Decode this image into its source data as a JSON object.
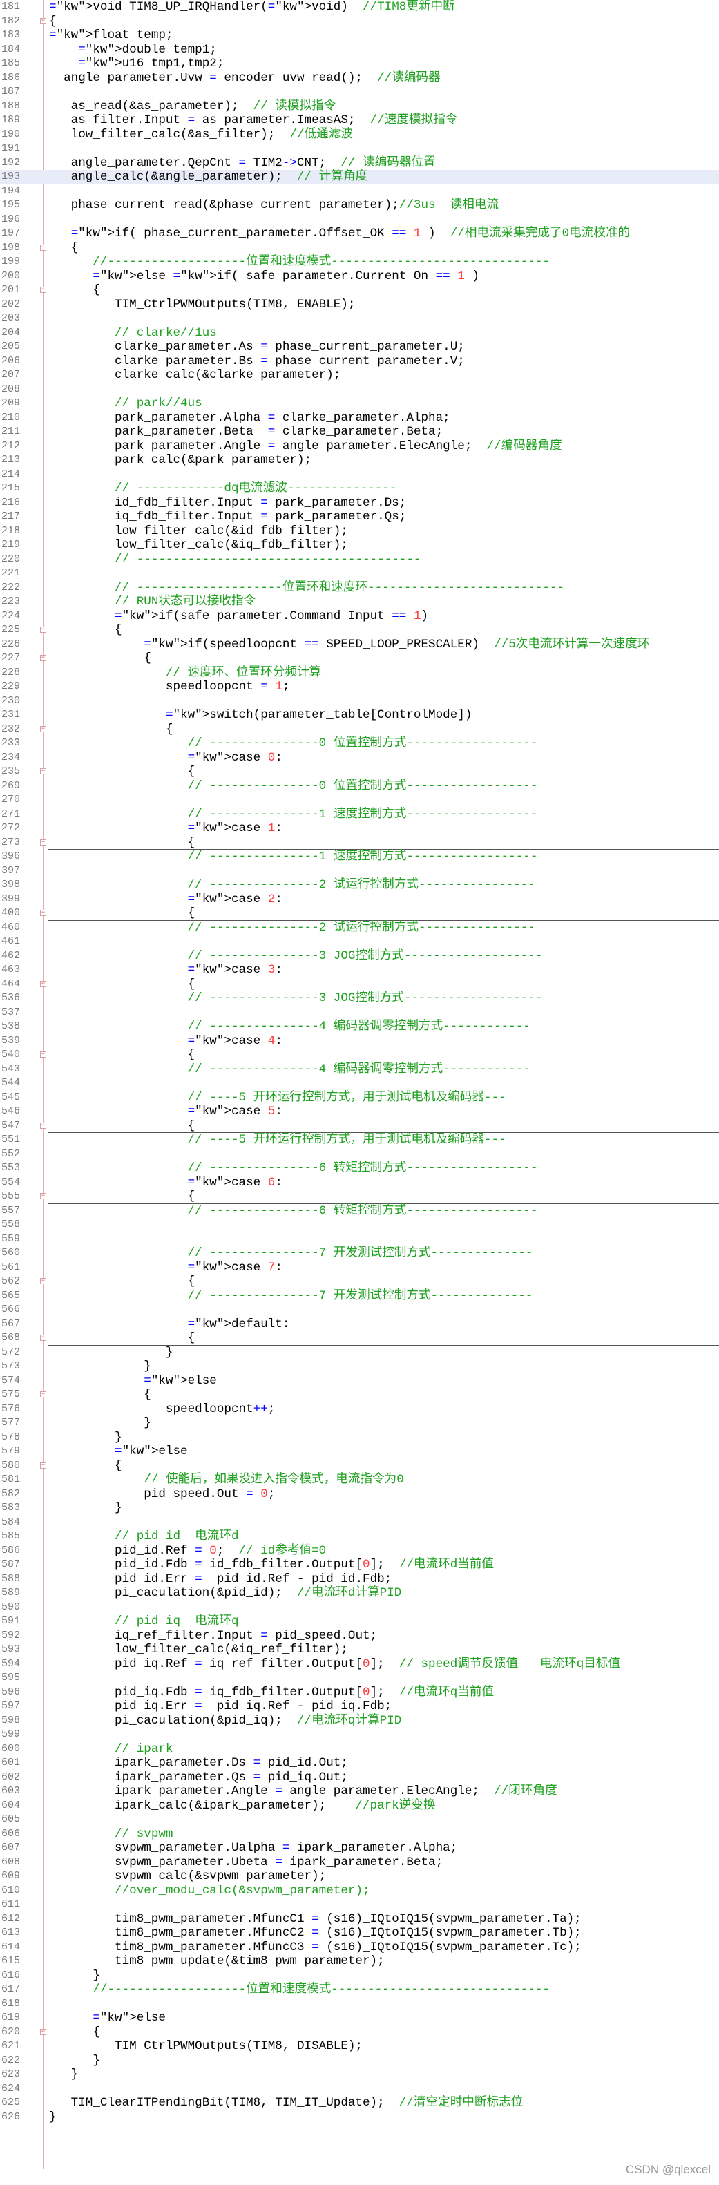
{
  "editor": {
    "lines": [
      {
        "n": "181",
        "t": "void TIM8_UP_IRQHandler(void)  //TIM8更新中断"
      },
      {
        "n": "182",
        "t": "{"
      },
      {
        "n": "183",
        "t": "float temp;"
      },
      {
        "n": "184",
        "t": "    double temp1;"
      },
      {
        "n": "185",
        "t": "    u16 tmp1,tmp2;"
      },
      {
        "n": "186",
        "t": "  angle_parameter.Uvw = encoder_uvw_read();  //读编码器"
      },
      {
        "n": "187",
        "t": ""
      },
      {
        "n": "188",
        "t": "   as_read(&as_parameter);  // 读模拟指令"
      },
      {
        "n": "189",
        "t": "   as_filter.Input = as_parameter.ImeasAS;  //速度模拟指令"
      },
      {
        "n": "190",
        "t": "   low_filter_calc(&as_filter);  //低通滤波"
      },
      {
        "n": "191",
        "t": ""
      },
      {
        "n": "192",
        "t": "   angle_parameter.QepCnt = TIM2->CNT;  // 读编码器位置"
      },
      {
        "n": "193",
        "t": "   angle_calc(&angle_parameter);  // 计算角度"
      },
      {
        "n": "194",
        "t": ""
      },
      {
        "n": "195",
        "t": "   phase_current_read(&phase_current_parameter);//3us  读相电流"
      },
      {
        "n": "196",
        "t": ""
      },
      {
        "n": "197",
        "t": "   if( phase_current_parameter.Offset_OK == 1 )  //相电流采集完成了0电流校准的"
      },
      {
        "n": "198",
        "t": "   {"
      },
      {
        "n": "199",
        "t": "      //-------------------位置和速度模式------------------------------"
      },
      {
        "n": "200",
        "t": "      else if( safe_parameter.Current_On == 1 )"
      },
      {
        "n": "201",
        "t": "      {"
      },
      {
        "n": "202",
        "t": "         TIM_CtrlPWMOutputs(TIM8, ENABLE);"
      },
      {
        "n": "203",
        "t": ""
      },
      {
        "n": "204",
        "t": "         // clarke//1us"
      },
      {
        "n": "205",
        "t": "         clarke_parameter.As = phase_current_parameter.U;"
      },
      {
        "n": "206",
        "t": "         clarke_parameter.Bs = phase_current_parameter.V;"
      },
      {
        "n": "207",
        "t": "         clarke_calc(&clarke_parameter);"
      },
      {
        "n": "208",
        "t": ""
      },
      {
        "n": "209",
        "t": "         // park//4us"
      },
      {
        "n": "210",
        "t": "         park_parameter.Alpha = clarke_parameter.Alpha;"
      },
      {
        "n": "211",
        "t": "         park_parameter.Beta  = clarke_parameter.Beta;"
      },
      {
        "n": "212",
        "t": "         park_parameter.Angle = angle_parameter.ElecAngle;  //编码器角度"
      },
      {
        "n": "213",
        "t": "         park_calc(&park_parameter);"
      },
      {
        "n": "214",
        "t": ""
      },
      {
        "n": "215",
        "t": "         // ------------dq电流滤波---------------"
      },
      {
        "n": "216",
        "t": "         id_fdb_filter.Input = park_parameter.Ds;"
      },
      {
        "n": "217",
        "t": "         iq_fdb_filter.Input = park_parameter.Qs;"
      },
      {
        "n": "218",
        "t": "         low_filter_calc(&id_fdb_filter);"
      },
      {
        "n": "219",
        "t": "         low_filter_calc(&iq_fdb_filter);"
      },
      {
        "n": "220",
        "t": "         // ---------------------------------------"
      },
      {
        "n": "221",
        "t": ""
      },
      {
        "n": "222",
        "t": "         // --------------------位置环和速度环---------------------------"
      },
      {
        "n": "223",
        "t": "         // RUN状态可以接收指令"
      },
      {
        "n": "224",
        "t": "         if(safe_parameter.Command_Input == 1)"
      },
      {
        "n": "225",
        "t": "         {"
      },
      {
        "n": "226",
        "t": "             if(speedloopcnt == SPEED_LOOP_PRESCALER)  //5次电流环计算一次速度环"
      },
      {
        "n": "227",
        "t": "             {"
      },
      {
        "n": "228",
        "t": "                // 速度环、位置环分频计算"
      },
      {
        "n": "229",
        "t": "                speedloopcnt = 1;"
      },
      {
        "n": "230",
        "t": ""
      },
      {
        "n": "231",
        "t": "                switch(parameter_table[ControlMode])"
      },
      {
        "n": "232",
        "t": "                {"
      },
      {
        "n": "233",
        "t": "                   // ---------------0 位置控制方式------------------"
      },
      {
        "n": "234",
        "t": "                   case 0:"
      },
      {
        "n": "235",
        "t": "                   {"
      },
      {
        "n": "269",
        "t": "                   // ---------------0 位置控制方式------------------"
      },
      {
        "n": "270",
        "t": ""
      },
      {
        "n": "271",
        "t": "                   // ---------------1 速度控制方式------------------"
      },
      {
        "n": "272",
        "t": "                   case 1:"
      },
      {
        "n": "273",
        "t": "                   {"
      },
      {
        "n": "396",
        "t": "                   // ---------------1 速度控制方式------------------"
      },
      {
        "n": "397",
        "t": ""
      },
      {
        "n": "398",
        "t": "                   // ---------------2 试运行控制方式----------------"
      },
      {
        "n": "399",
        "t": "                   case 2:"
      },
      {
        "n": "400",
        "t": "                   {"
      },
      {
        "n": "460",
        "t": "                   // ---------------2 试运行控制方式----------------"
      },
      {
        "n": "461",
        "t": ""
      },
      {
        "n": "462",
        "t": "                   // ---------------3 JOG控制方式-------------------"
      },
      {
        "n": "463",
        "t": "                   case 3:"
      },
      {
        "n": "464",
        "t": "                   {"
      },
      {
        "n": "536",
        "t": "                   // ---------------3 JOG控制方式-------------------"
      },
      {
        "n": "537",
        "t": ""
      },
      {
        "n": "538",
        "t": "                   // ---------------4 编码器调零控制方式------------"
      },
      {
        "n": "539",
        "t": "                   case 4:"
      },
      {
        "n": "540",
        "t": "                   {"
      },
      {
        "n": "543",
        "t": "                   // ---------------4 编码器调零控制方式------------"
      },
      {
        "n": "544",
        "t": ""
      },
      {
        "n": "545",
        "t": "                   // ----5 开环运行控制方式，用于测试电机及编码器---"
      },
      {
        "n": "546",
        "t": "                   case 5:"
      },
      {
        "n": "547",
        "t": "                   {"
      },
      {
        "n": "551",
        "t": "                   // ----5 开环运行控制方式，用于测试电机及编码器---"
      },
      {
        "n": "552",
        "t": ""
      },
      {
        "n": "553",
        "t": "                   // ---------------6 转矩控制方式------------------"
      },
      {
        "n": "554",
        "t": "                   case 6:"
      },
      {
        "n": "555",
        "t": "                   {"
      },
      {
        "n": "557",
        "t": "                   // ---------------6 转矩控制方式------------------"
      },
      {
        "n": "558",
        "t": ""
      },
      {
        "n": "559",
        "t": ""
      },
      {
        "n": "560",
        "t": "                   // ---------------7 开发测试控制方式--------------"
      },
      {
        "n": "561",
        "t": "                   case 7:"
      },
      {
        "n": "562",
        "t": "                   {"
      },
      {
        "n": "565",
        "t": "                   // ---------------7 开发测试控制方式--------------"
      },
      {
        "n": "566",
        "t": ""
      },
      {
        "n": "567",
        "t": "                   default:"
      },
      {
        "n": "568",
        "t": "                   {"
      },
      {
        "n": "572",
        "t": "                }"
      },
      {
        "n": "573",
        "t": "             }"
      },
      {
        "n": "574",
        "t": "             else"
      },
      {
        "n": "575",
        "t": "             {"
      },
      {
        "n": "576",
        "t": "                speedloopcnt++;"
      },
      {
        "n": "577",
        "t": "             }"
      },
      {
        "n": "578",
        "t": "         }"
      },
      {
        "n": "579",
        "t": "         else"
      },
      {
        "n": "580",
        "t": "         {"
      },
      {
        "n": "581",
        "t": "             // 使能后，如果没进入指令模式，电流指令为0"
      },
      {
        "n": "582",
        "t": "             pid_speed.Out = 0;"
      },
      {
        "n": "583",
        "t": "         }"
      },
      {
        "n": "584",
        "t": ""
      },
      {
        "n": "585",
        "t": "         // pid_id  电流环d"
      },
      {
        "n": "586",
        "t": "         pid_id.Ref = 0;  // id参考值=0"
      },
      {
        "n": "587",
        "t": "         pid_id.Fdb = id_fdb_filter.Output[0];  //电流环d当前值"
      },
      {
        "n": "588",
        "t": "         pid_id.Err =  pid_id.Ref - pid_id.Fdb;"
      },
      {
        "n": "589",
        "t": "         pi_caculation(&pid_id);  //电流环d计算PID"
      },
      {
        "n": "590",
        "t": ""
      },
      {
        "n": "591",
        "t": "         // pid_iq  电流环q"
      },
      {
        "n": "592",
        "t": "         iq_ref_filter.Input = pid_speed.Out;"
      },
      {
        "n": "593",
        "t": "         low_filter_calc(&iq_ref_filter);"
      },
      {
        "n": "594",
        "t": "         pid_iq.Ref = iq_ref_filter.Output[0];  // speed调节反馈值   电流环q目标值"
      },
      {
        "n": "595",
        "t": ""
      },
      {
        "n": "596",
        "t": "         pid_iq.Fdb = iq_fdb_filter.Output[0];  //电流环q当前值"
      },
      {
        "n": "597",
        "t": "         pid_iq.Err =  pid_iq.Ref - pid_iq.Fdb;"
      },
      {
        "n": "598",
        "t": "         pi_caculation(&pid_iq);  //电流环q计算PID"
      },
      {
        "n": "599",
        "t": ""
      },
      {
        "n": "600",
        "t": "         // ipark"
      },
      {
        "n": "601",
        "t": "         ipark_parameter.Ds = pid_id.Out;"
      },
      {
        "n": "602",
        "t": "         ipark_parameter.Qs = pid_iq.Out;"
      },
      {
        "n": "603",
        "t": "         ipark_parameter.Angle = angle_parameter.ElecAngle;  //闭环角度"
      },
      {
        "n": "604",
        "t": "         ipark_calc(&ipark_parameter);    //park逆变换"
      },
      {
        "n": "605",
        "t": ""
      },
      {
        "n": "606",
        "t": "         // svpwm"
      },
      {
        "n": "607",
        "t": "         svpwm_parameter.Ualpha = ipark_parameter.Alpha;"
      },
      {
        "n": "608",
        "t": "         svpwm_parameter.Ubeta = ipark_parameter.Beta;"
      },
      {
        "n": "609",
        "t": "         svpwm_calc(&svpwm_parameter);"
      },
      {
        "n": "610",
        "t": "         //over_modu_calc(&svpwm_parameter);"
      },
      {
        "n": "611",
        "t": ""
      },
      {
        "n": "612",
        "t": "         tim8_pwm_parameter.MfuncC1 = (s16)_IQtoIQ15(svpwm_parameter.Ta);"
      },
      {
        "n": "613",
        "t": "         tim8_pwm_parameter.MfuncC2 = (s16)_IQtoIQ15(svpwm_parameter.Tb);"
      },
      {
        "n": "614",
        "t": "         tim8_pwm_parameter.MfuncC3 = (s16)_IQtoIQ15(svpwm_parameter.Tc);"
      },
      {
        "n": "615",
        "t": "         tim8_pwm_update(&tim8_pwm_parameter);"
      },
      {
        "n": "616",
        "t": "      }"
      },
      {
        "n": "617",
        "t": "      //-------------------位置和速度模式------------------------------"
      },
      {
        "n": "618",
        "t": ""
      },
      {
        "n": "619",
        "t": "      else"
      },
      {
        "n": "620",
        "t": "      {"
      },
      {
        "n": "621",
        "t": "         TIM_CtrlPWMOutputs(TIM8, DISABLE);"
      },
      {
        "n": "622",
        "t": "      }"
      },
      {
        "n": "623",
        "t": "   }"
      },
      {
        "n": "624",
        "t": ""
      },
      {
        "n": "625",
        "t": "   TIM_ClearITPendingBit(TIM8, TIM_IT_Update);  //清空定时中断标志位"
      },
      {
        "n": "626",
        "t": "}"
      }
    ],
    "highlighted_lines": [
      "193"
    ],
    "fold_lines": [
      "182",
      "198",
      "201",
      "225",
      "227",
      "232",
      "235",
      "273",
      "400",
      "464",
      "540",
      "547",
      "555",
      "562",
      "568",
      "575",
      "580",
      "620"
    ],
    "separator_after": [
      "235",
      "273",
      "400",
      "464",
      "540",
      "547",
      "555",
      "568"
    ]
  },
  "watermark": "CSDN @qlexcel",
  "colors": {
    "keyword": "#0000ff",
    "comment": "#20a020",
    "number": "#ff3b3b",
    "highlight": "#e8ecf8"
  }
}
